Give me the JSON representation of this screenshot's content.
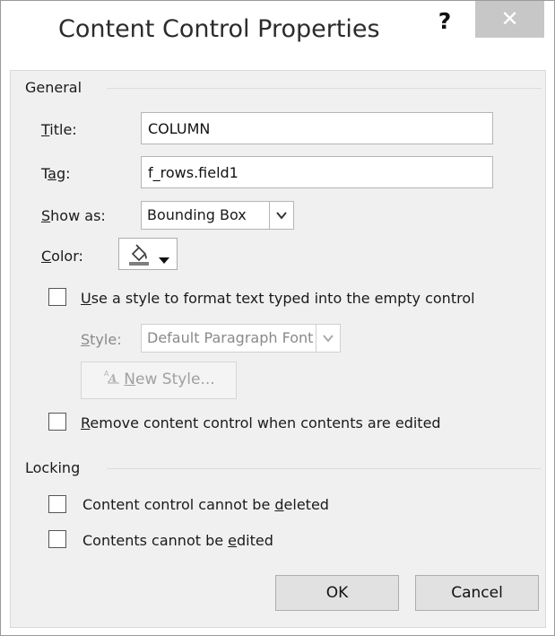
{
  "window": {
    "title": "Content Control Properties",
    "help_glyph": "?",
    "close_glyph": "✕"
  },
  "general": {
    "heading": "General",
    "title_label": {
      "key": "T",
      "rest": "itle:"
    },
    "title_value": "COLUMN",
    "tag_label": {
      "pre": "T",
      "key": "a",
      "rest": "g:"
    },
    "tag_value": "f_rows.field1",
    "show_as_label": {
      "key": "S",
      "rest": "how as:"
    },
    "show_as_value": "Bounding Box",
    "color_label": {
      "key": "C",
      "rest": "olor:"
    },
    "use_style_checkbox": {
      "checked": false,
      "key": "U",
      "rest": "se a style to format text typed into the empty control"
    },
    "style_label": {
      "key": "S",
      "rest": "tyle:"
    },
    "style_value": "Default Paragraph Font",
    "new_style_button": {
      "key": "N",
      "rest": "ew Style..."
    },
    "remove_checkbox": {
      "checked": false,
      "key": "R",
      "rest": "emove content control when contents are edited"
    }
  },
  "locking": {
    "heading": "Locking",
    "cannot_delete": {
      "checked": false,
      "pre": "Content control cannot be ",
      "key": "d",
      "rest": "eleted"
    },
    "cannot_edit": {
      "checked": false,
      "pre": "Contents cannot be ",
      "key": "e",
      "rest": "dited"
    }
  },
  "buttons": {
    "ok": "OK",
    "cancel": "Cancel"
  }
}
